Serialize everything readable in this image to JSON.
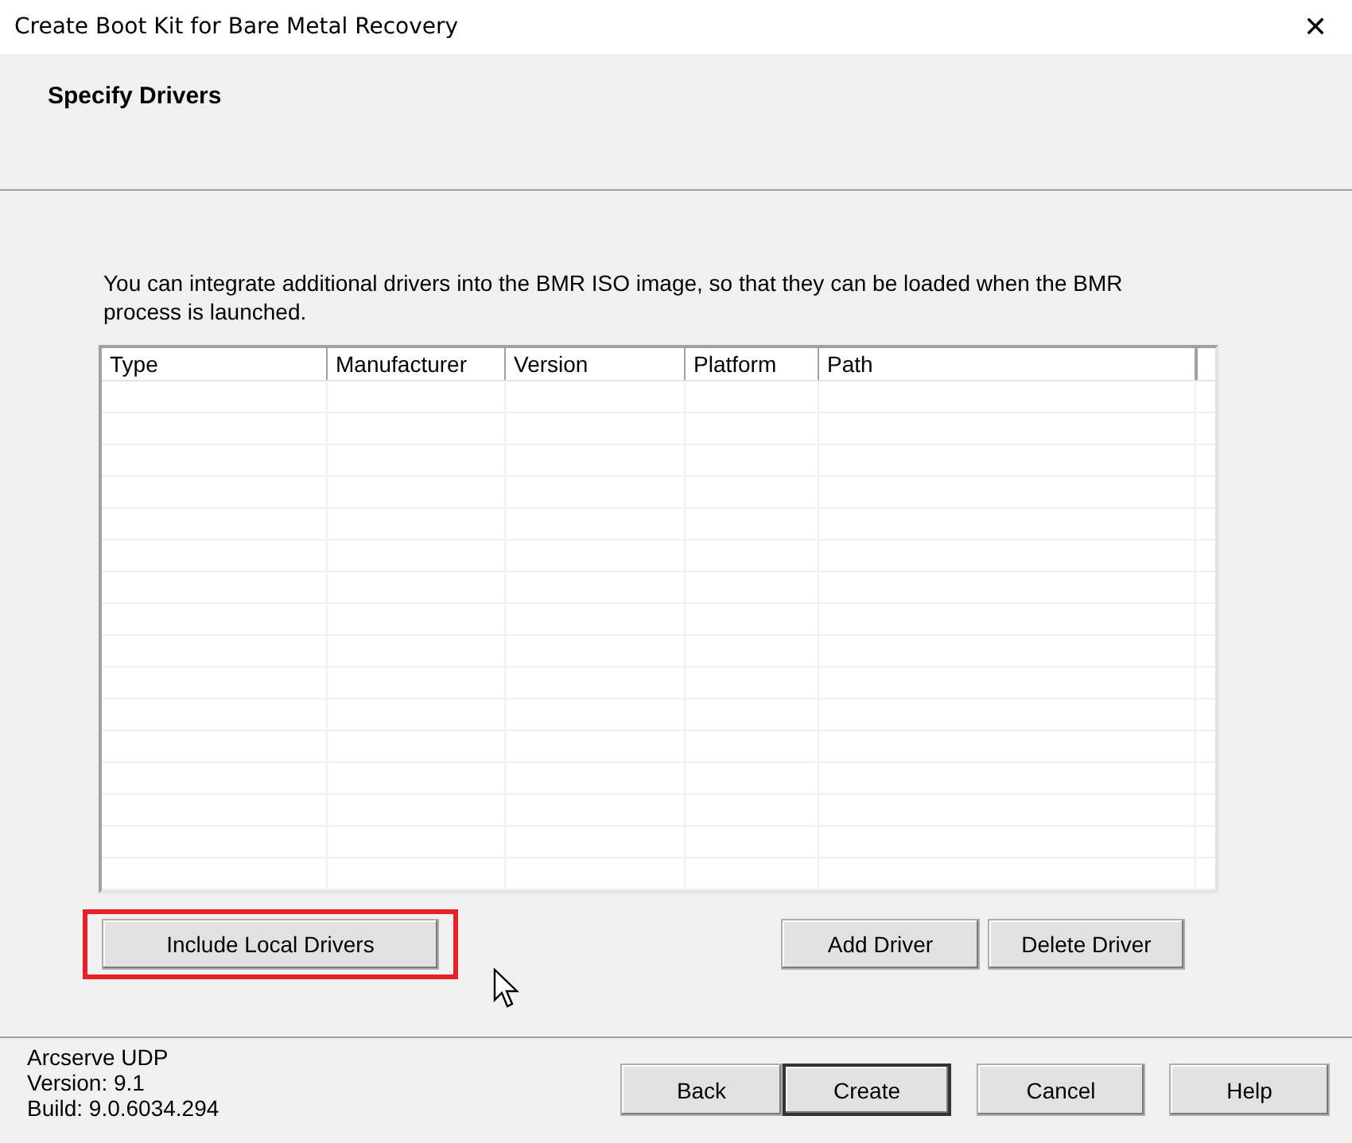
{
  "window": {
    "title": "Create Boot Kit for Bare Metal Recovery",
    "close": "✕"
  },
  "header": {
    "title": "Specify Drivers"
  },
  "description": "You can integrate additional drivers into the BMR ISO image, so that they can be loaded when the BMR process is launched.",
  "table": {
    "columns": [
      "Type",
      "Manufacturer",
      "Version",
      "Platform",
      "Path"
    ]
  },
  "actions": [
    {
      "label": "Include Local Drivers",
      "highlighted": true
    },
    {
      "label": "Add Driver",
      "highlighted": false
    },
    {
      "label": "Delete Driver",
      "highlighted": false
    }
  ],
  "product": {
    "name": "Arcserve UDP",
    "version": "Version: 9.1",
    "build": "Build: 9.0.6034.294"
  },
  "buttons": [
    {
      "label": "Back",
      "default": false
    },
    {
      "label": "Create",
      "default": true
    },
    {
      "label": "Cancel",
      "default": false
    },
    {
      "label": "Help",
      "default": false
    }
  ]
}
